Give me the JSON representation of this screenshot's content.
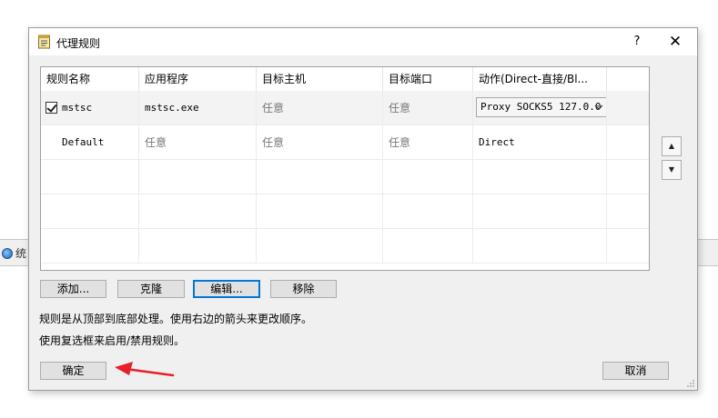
{
  "background": {
    "item_label": "统"
  },
  "dialog": {
    "title": "代理规则",
    "help_symbol": "?",
    "close_symbol": "✕"
  },
  "table": {
    "columns": [
      "规则名称",
      "应用程序",
      "目标主机",
      "目标端口",
      "动作(Direct-直接/Bl..."
    ],
    "rows": [
      {
        "checked": true,
        "name": "mstsc",
        "app": "mstsc.exe",
        "host": "任意",
        "port": "任意",
        "action": "Proxy SOCKS5 127.0.0"
      },
      {
        "checked": false,
        "name": "Default",
        "app": "任意",
        "host": "任意",
        "port": "任意",
        "action": "Direct"
      }
    ]
  },
  "buttons": {
    "add": "添加...",
    "clone": "克隆",
    "edit": "编辑...",
    "remove": "移除",
    "ok": "确定",
    "cancel": "取消",
    "move_up": "▲",
    "move_down": "▼"
  },
  "info": {
    "line1": "规则是从顶部到底部处理。使用右边的箭头来更改顺序。",
    "line2": "使用复选框来启用/禁用规则。"
  },
  "colors": {
    "accent": "#0078d7",
    "annotation_arrow": "#e8202a"
  }
}
